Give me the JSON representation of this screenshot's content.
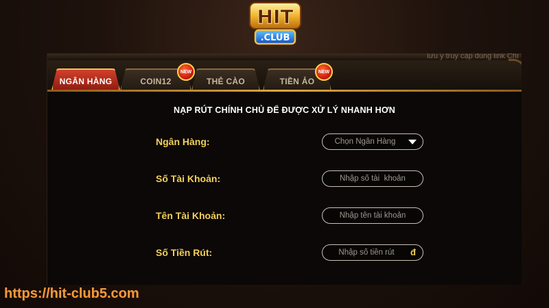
{
  "logo": {
    "top_text": "HIT",
    "bottom_text": ".CLUB"
  },
  "top_notice": "lưu ý truy cập đúng link Chí",
  "tabs": [
    {
      "label": "NGÂN HÀNG",
      "active": true,
      "new": false
    },
    {
      "label": "COIN12",
      "active": false,
      "new": true
    },
    {
      "label": "THẺ CÀO",
      "active": false,
      "new": false
    },
    {
      "label": "TIỀN ẢO",
      "active": false,
      "new": true
    }
  ],
  "badge_text": "NEW",
  "form": {
    "title": "NẠP RÚT CHÍNH CHỦ ĐỂ ĐƯỢC XỬ LÝ NHANH HƠN",
    "bank_label": "Ngân Hàng:",
    "bank_select_value": "Chọn Ngân Hàng",
    "account_number_label": "Số Tài Khoản:",
    "account_number_placeholder": "Nhập số tài  khoản",
    "account_name_label": "Tên Tài Khoản:",
    "account_name_placeholder": "Nhập tên tài khoản",
    "amount_label": "Số Tiền Rút:",
    "amount_placeholder": "Nhập số tiền rút",
    "currency_symbol": "đ"
  },
  "site_url": "https://hit-club5.com",
  "colors": {
    "active_tab": "#c62e1c",
    "gold_label": "#f2cf5a",
    "url_orange": "#f49a3c"
  }
}
